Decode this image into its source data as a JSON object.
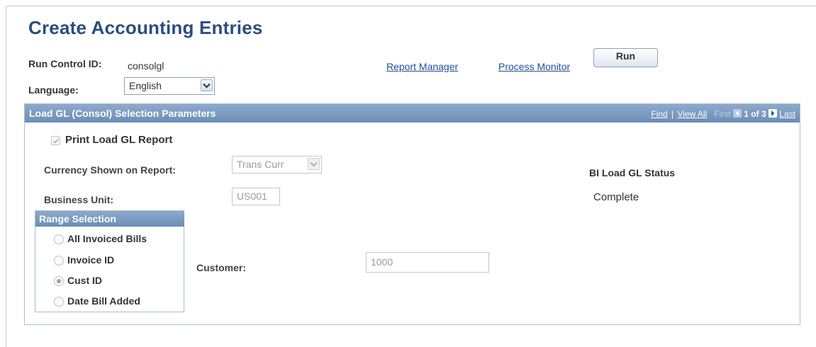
{
  "page": {
    "title": "Create Accounting Entries"
  },
  "run_control": {
    "label": "Run Control ID:",
    "value": "consolgl"
  },
  "language": {
    "label": "Language:",
    "selected": "English"
  },
  "links": {
    "report_manager": "Report Manager",
    "process_monitor": "Process Monitor"
  },
  "run_button": {
    "label": "Run"
  },
  "panel": {
    "title": "Load GL (Consol) Selection Parameters",
    "nav": {
      "find": "Find",
      "sep": "|",
      "view_all": "View All",
      "first": "First",
      "page_count": "1 of 3",
      "last": "Last"
    },
    "print_report": {
      "label": "Print Load GL Report",
      "checked": true
    },
    "currency": {
      "label": "Currency Shown on Report:",
      "selected": "Trans Curr"
    },
    "business_unit": {
      "label": "Business Unit:",
      "value": "US001"
    },
    "status": {
      "label": "BI Load GL Status",
      "value": "Complete"
    },
    "range": {
      "title": "Range Selection",
      "options": [
        "All Invoiced Bills",
        "Invoice ID",
        "Cust ID",
        "Date Bill Added"
      ],
      "selected": "Cust ID"
    },
    "customer": {
      "label": "Customer:",
      "value": "1000"
    }
  },
  "colors": {
    "title_blue": "#2a4d7f",
    "header_blue": "#7a9ac0",
    "link_blue": "#1f4e96"
  },
  "icons": {
    "dropdown": "chevron-down-icon",
    "prev": "previous-arrow-icon",
    "next": "next-arrow-icon",
    "check": "checkmark-icon"
  }
}
